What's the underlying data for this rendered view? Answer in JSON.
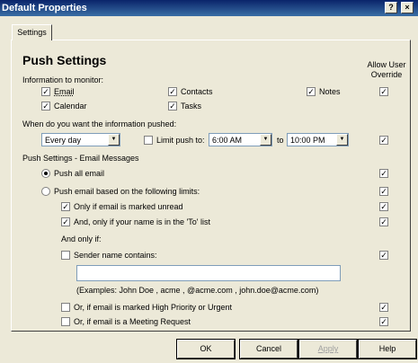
{
  "window": {
    "title": "Default Properties",
    "help_button": "?",
    "close_button": "×"
  },
  "tabs": [
    "Settings"
  ],
  "main": {
    "heading": "Push Settings",
    "allow_override_header": "Allow User Override",
    "monitor_label": "Information to monitor:",
    "monitor_items": [
      {
        "label": "Email",
        "checked": true
      },
      {
        "label": "Contacts",
        "checked": true
      },
      {
        "label": "Notes",
        "checked": true
      },
      {
        "label": "Calendar",
        "checked": true
      },
      {
        "label": "Tasks",
        "checked": true
      }
    ],
    "when_label": "When do you want the information pushed:",
    "frequency": "Every day",
    "limit_push_label": "Limit push to:",
    "limit_push_checked": false,
    "time_from": "6:00 AM",
    "to_label": "to",
    "time_to": "10:00 PM",
    "email_section_label": "Push Settings - Email Messages",
    "push_all_label": "Push all email",
    "push_limits_label": "Push email based on the following limits:",
    "only_unread_label": "Only if email is marked unread",
    "only_unread_checked": true,
    "only_to_label": "And, only if your name is in the 'To' list",
    "only_to_checked": true,
    "and_only_if_label": "And only if:",
    "sender_contains_label": "Sender name contains:",
    "sender_contains_checked": false,
    "sender_value": "",
    "examples_text": "(Examples: John Doe , acme , @acme.com , john.doe@acme.com)",
    "high_priority_label": "Or, if email is marked High Priority or Urgent",
    "high_priority_checked": false,
    "meeting_request_label": "Or, if email is a Meeting Request",
    "meeting_request_checked": false,
    "check_glyph": "✓"
  },
  "buttons": {
    "ok": "OK",
    "cancel": "Cancel",
    "apply": "Apply",
    "help": "Help"
  }
}
